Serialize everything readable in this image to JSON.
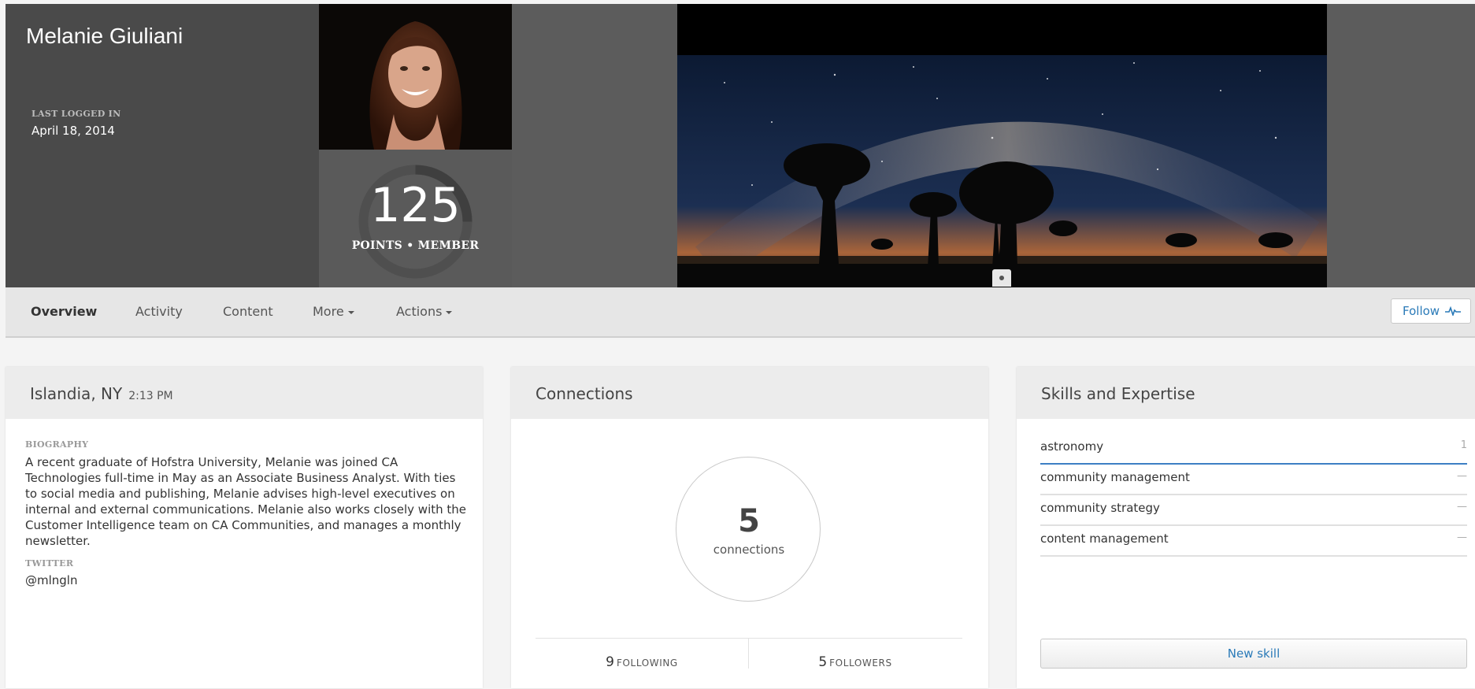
{
  "profile": {
    "name": "Melanie Giuliani",
    "last_logged_in_label": "LAST LOGGED IN",
    "last_logged_in_date": "April 18, 2014",
    "points": "125",
    "points_label": "POINTS • MEMBER",
    "points_progress": 0.25
  },
  "nav": {
    "items": [
      {
        "label": "Overview"
      },
      {
        "label": "Activity"
      },
      {
        "label": "Content"
      },
      {
        "label": "More"
      },
      {
        "label": "Actions"
      }
    ],
    "follow_label": "Follow"
  },
  "location_card": {
    "location": "Islandia, NY",
    "time": "2:13 PM",
    "bio_label": "BIOGRAPHY",
    "bio_text": "A recent graduate of Hofstra University, Melanie was joined CA Technologies full-time in May as an Associate Business Analyst. With ties to social media and publishing, Melanie advises high-level executives on internal and external communications. Melanie also works closely with the Customer Intelligence team on CA Communities, and manages a monthly newsletter.",
    "twitter_label": "TWITTER",
    "twitter_handle": "@mlngln"
  },
  "connections_card": {
    "title": "Connections",
    "count": "5",
    "count_label": "connections",
    "following_count": "9",
    "following_label": "FOLLOWING",
    "followers_count": "5",
    "followers_label": "FOLLOWERS"
  },
  "skills_card": {
    "title": "Skills and Expertise",
    "skills": [
      {
        "name": "astronomy",
        "count": "1"
      },
      {
        "name": "community management",
        "count": "—"
      },
      {
        "name": "community strategy",
        "count": "—"
      },
      {
        "name": "content management",
        "count": "—"
      }
    ],
    "new_skill_label": "New skill"
  },
  "colors": {
    "accent": "#2a7ab8",
    "banner": "#5c5c5c",
    "info_panel": "#4a4a4a"
  }
}
